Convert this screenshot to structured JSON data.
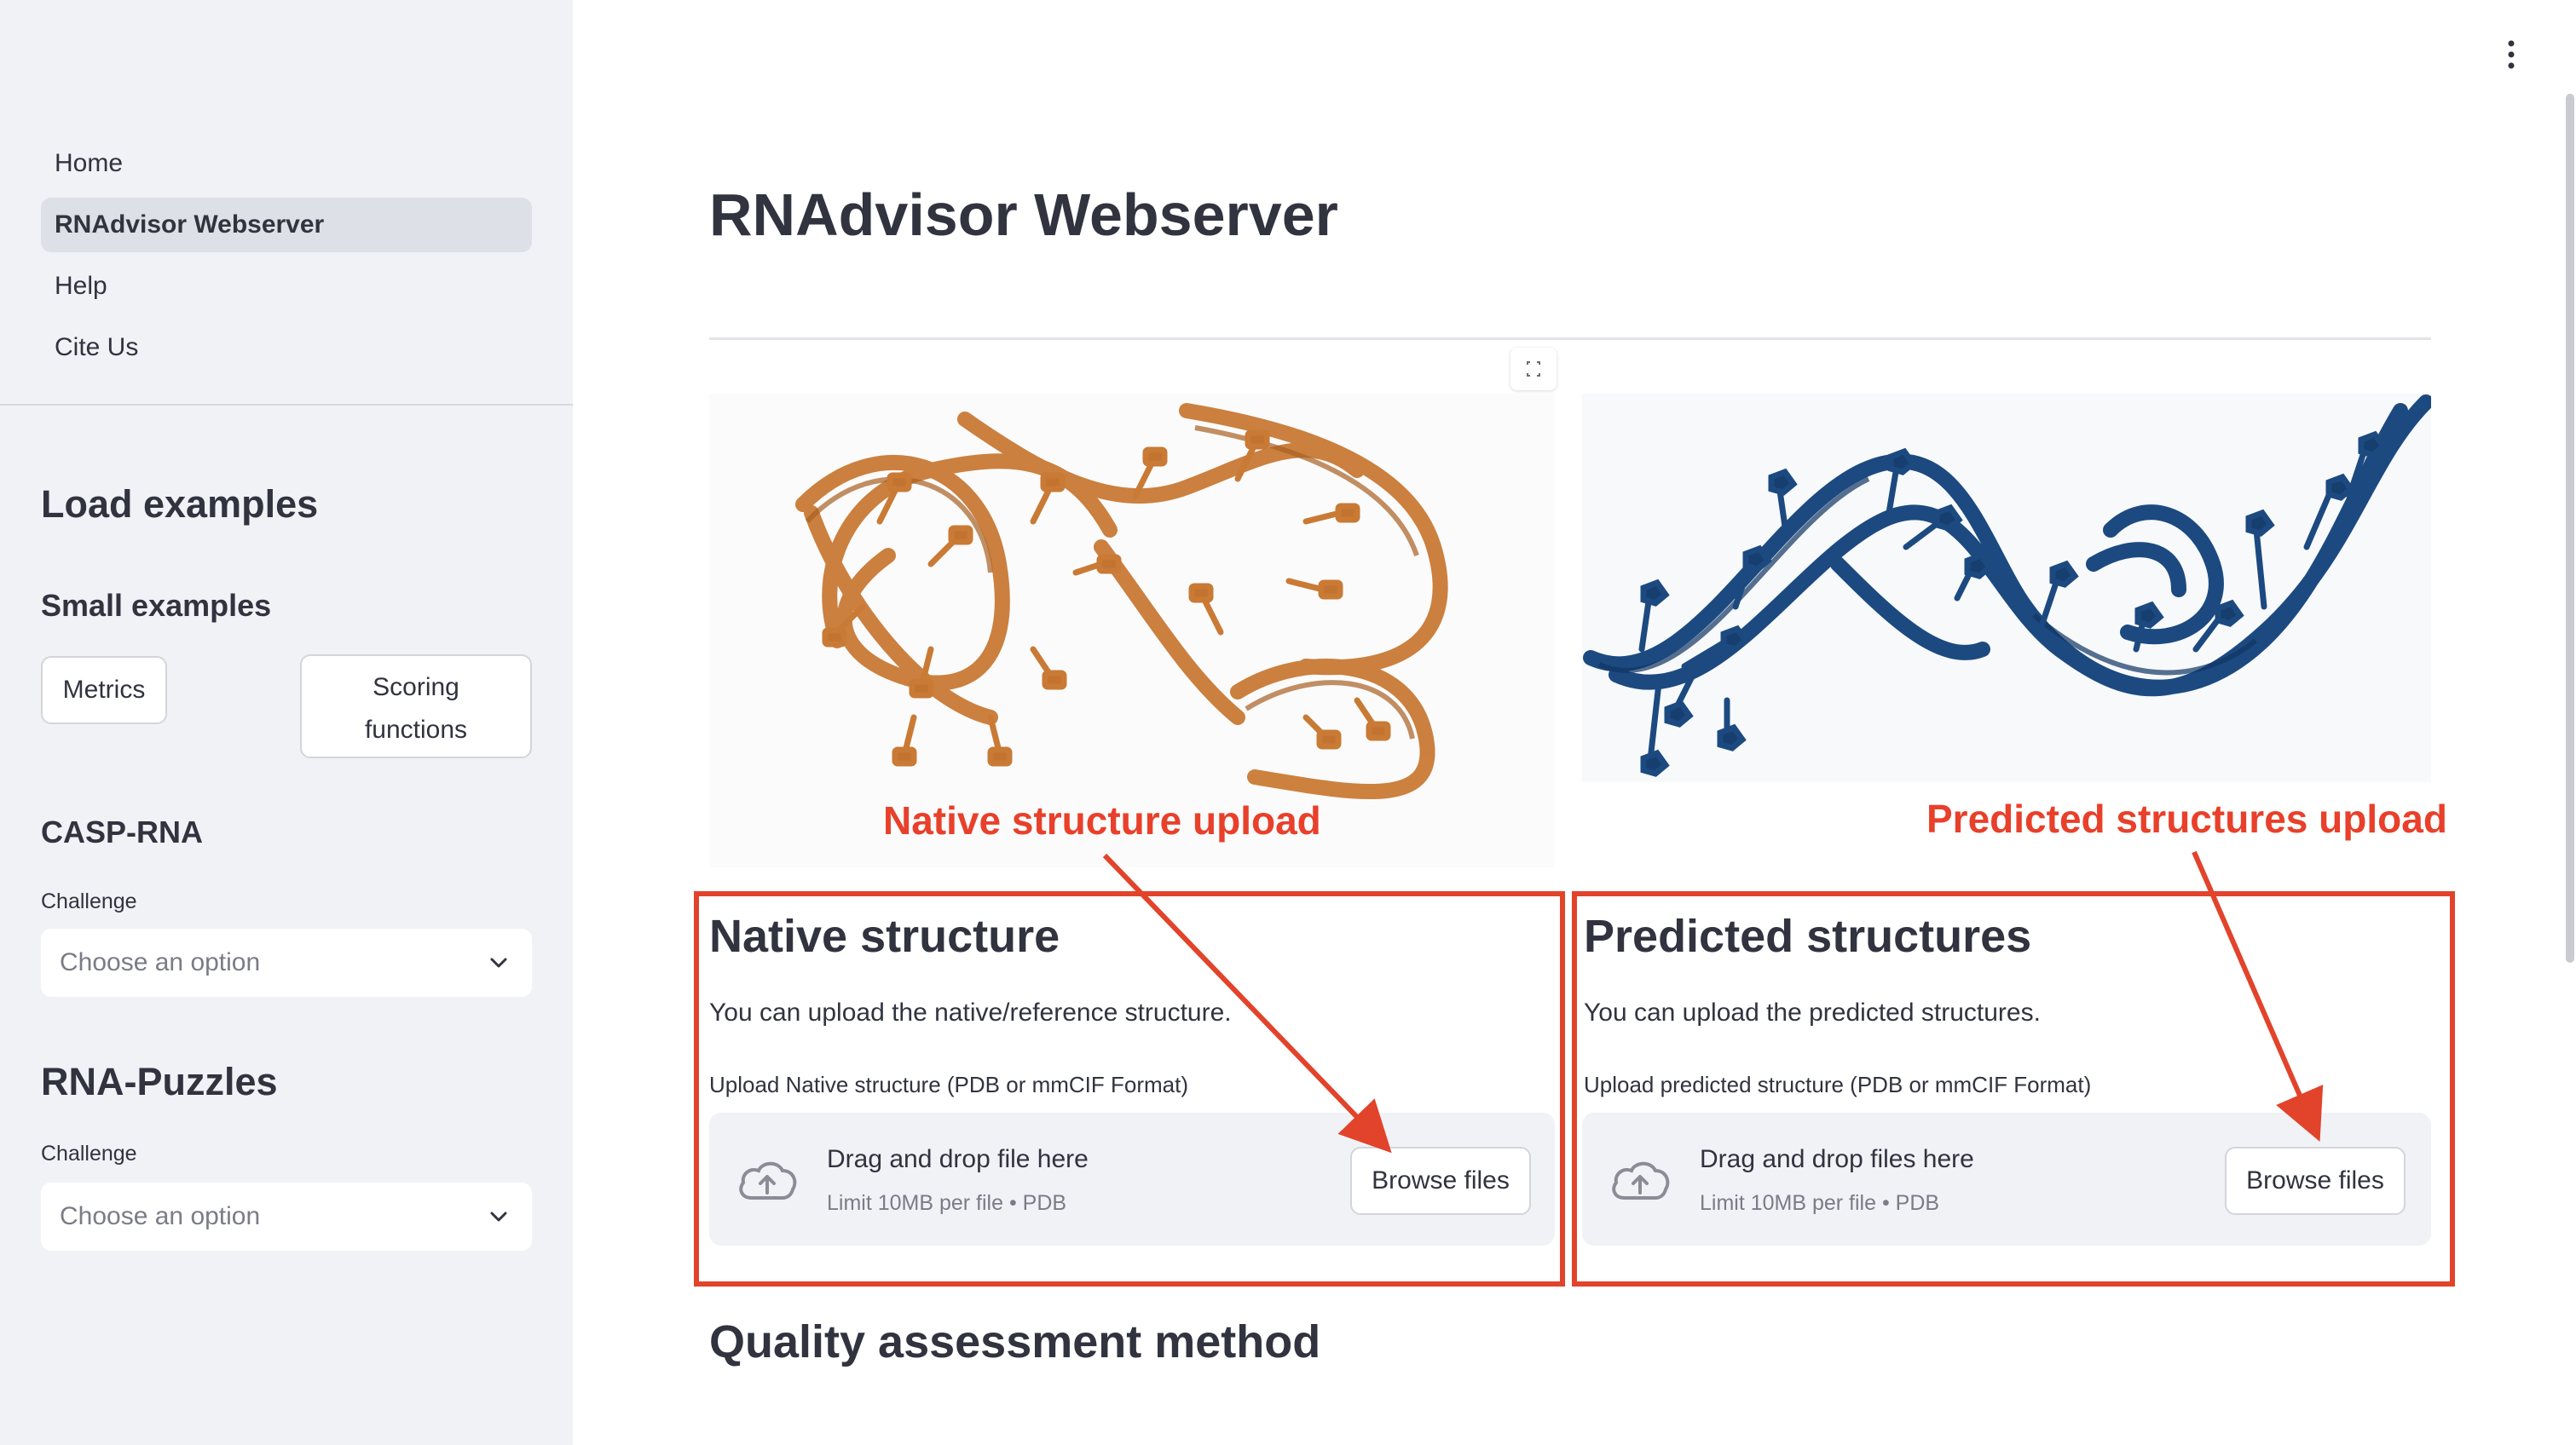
{
  "sidebar": {
    "nav_items": [
      {
        "label": "Home",
        "active": false
      },
      {
        "label": "RNAdvisor Webserver",
        "active": true
      },
      {
        "label": "Help",
        "active": false
      },
      {
        "label": "Cite Us",
        "active": false
      }
    ],
    "load_examples_title": "Load examples",
    "small_examples_title": "Small examples",
    "metrics_button": "Metrics",
    "scoring_button_line1": "Scoring",
    "scoring_button_line2": "functions",
    "casp_title": "CASP-RNA",
    "casp_challenge_label": "Challenge",
    "casp_select_placeholder": "Choose an option",
    "puzzles_title": "RNA-Puzzles",
    "puzzles_challenge_label": "Challenge",
    "puzzles_select_placeholder": "Choose an option"
  },
  "main": {
    "title": "RNAdvisor Webserver",
    "annotation_native": "Native structure upload",
    "annotation_predicted": "Predicted structures upload",
    "native": {
      "heading": "Native structure",
      "description": "You can upload the native/reference structure.",
      "upload_label": "Upload Native structure (PDB or mmCIF Format)",
      "drop_text": "Drag and drop file here",
      "limit_text": "Limit 10MB per file • PDB",
      "browse_label": "Browse files"
    },
    "predicted": {
      "heading": "Predicted structures",
      "description": "You can upload the predicted structures.",
      "upload_label": "Upload predicted structure (PDB or mmCIF Format)",
      "drop_text": "Drag and drop files here",
      "limit_text": "Limit 10MB per file • PDB",
      "browse_label": "Browse files"
    },
    "quality_heading": "Quality assessment method"
  },
  "icons": {
    "menu": "vertical-dots-icon",
    "expand": "fullscreen-icon",
    "upload": "cloud-upload-icon",
    "chevron": "chevron-down-icon"
  },
  "colors": {
    "sidebar_bg": "#f0f2f6",
    "active_nav_bg": "#dde0e6",
    "annotation_red": "#e8402a",
    "native_rna": "#c97a35",
    "predicted_rna": "#1c4a80"
  }
}
